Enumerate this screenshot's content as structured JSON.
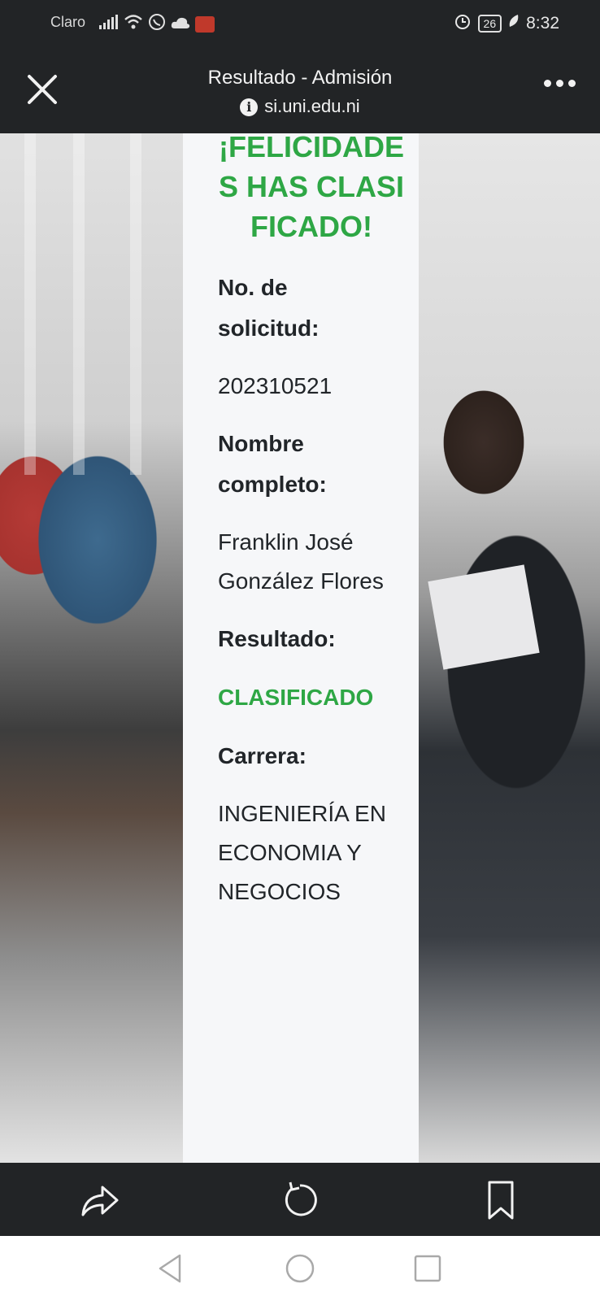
{
  "status_bar": {
    "carrier": "Claro",
    "battery": "26",
    "time": "8:32"
  },
  "browser": {
    "title": "Resultado - Admisión",
    "url": "si.uni.edu.ni"
  },
  "card": {
    "title": "¡FELICIDADES HAS CLASIFICADO!",
    "fields": [
      {
        "label": "No. de solicitud:",
        "value": "202310521"
      },
      {
        "label": "Nombre completo:",
        "value": "Franklin José González Flores"
      },
      {
        "label": "Resultado:",
        "value": "CLASIFICADO"
      },
      {
        "label": "Carrera:",
        "value": "INGENIERÍA EN ECONOMIA Y NEGOCIOS"
      }
    ]
  },
  "icons": {
    "close": "close-icon",
    "menu": "more-icon",
    "info": "info-icon",
    "share": "share-icon",
    "reload": "reload-icon",
    "bookmark": "bookmark-icon",
    "nav_back": "back-icon",
    "nav_home": "home-icon",
    "nav_recent": "recents-icon"
  },
  "colors": {
    "accent_green": "#2ea745",
    "chrome_dark": "#222426"
  }
}
